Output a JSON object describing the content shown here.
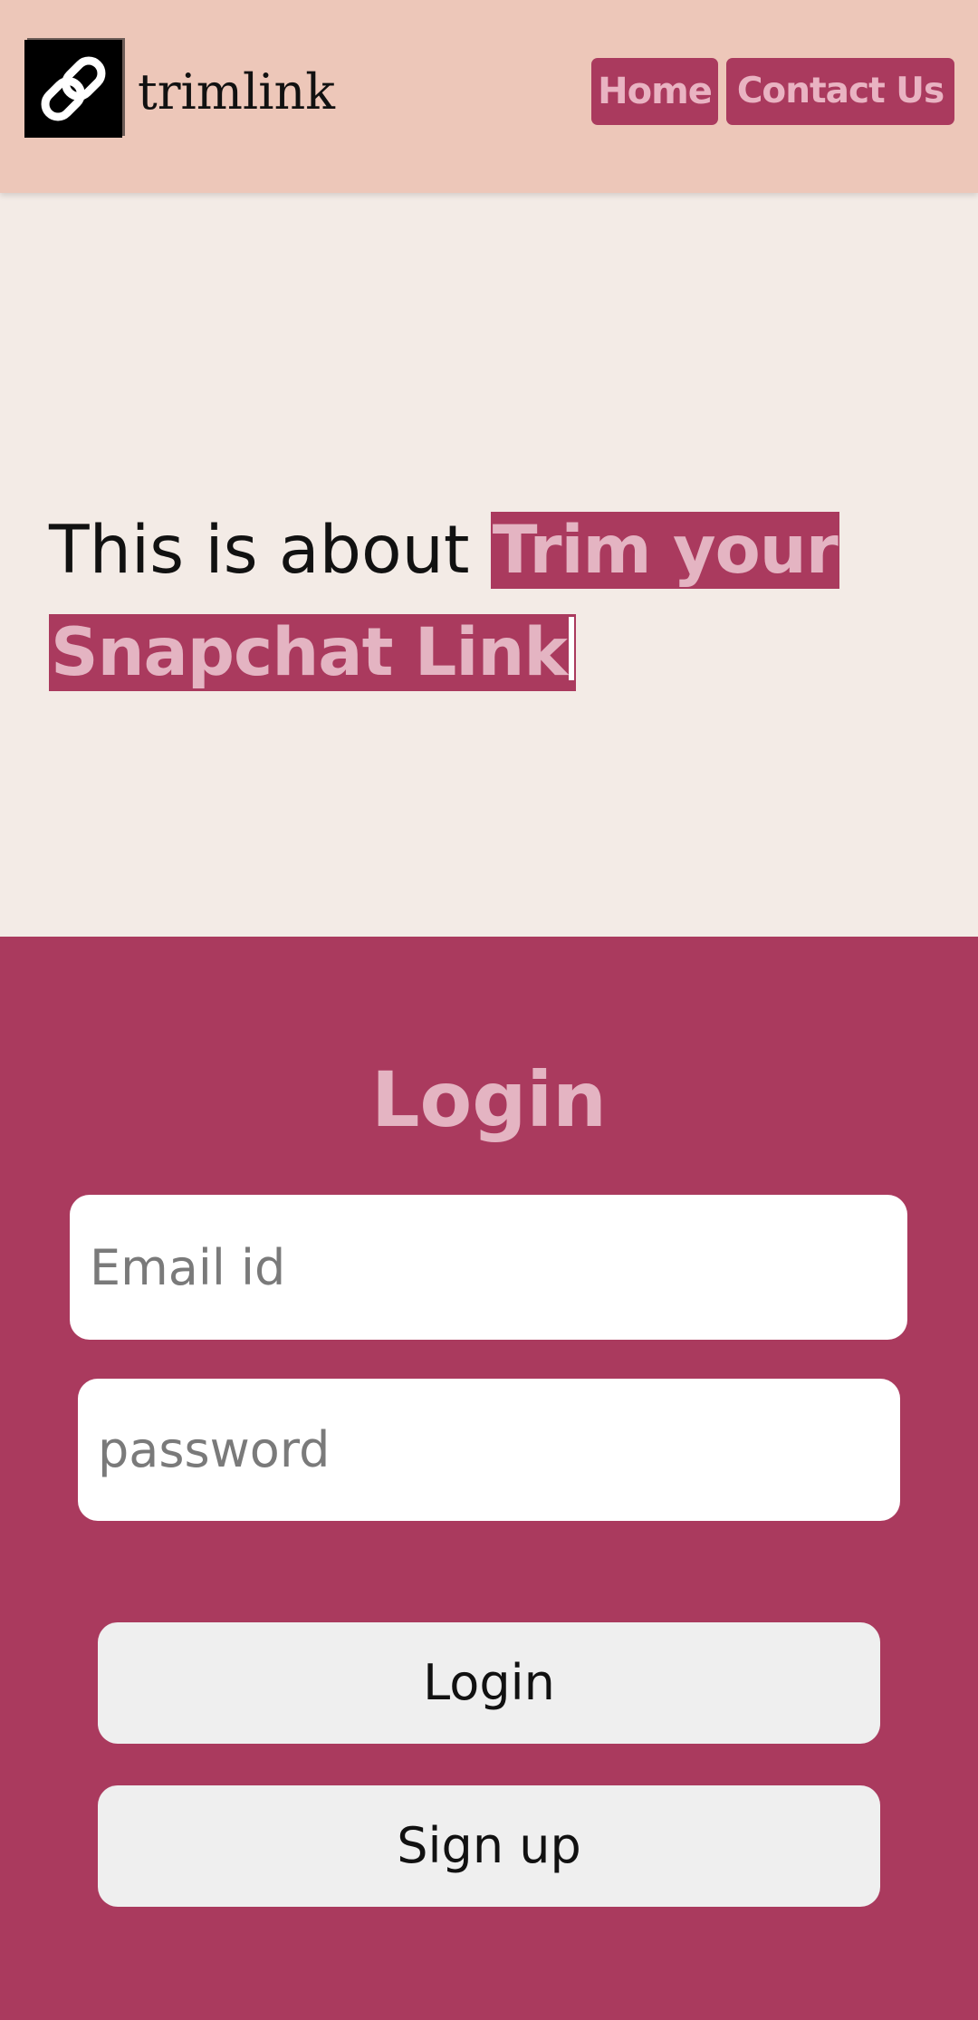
{
  "header": {
    "logo_icon": "link-icon",
    "brand": "trimlink",
    "nav": {
      "home_label": "Home",
      "contact_label": "Contact Us"
    }
  },
  "hero": {
    "lead_text": "This is about ",
    "highlight_text": "Trim your Snapchat Link"
  },
  "login": {
    "title": "Login",
    "email_placeholder": "Email id",
    "password_placeholder": "password",
    "login_label": "Login",
    "signup_label": "Sign up"
  },
  "colors": {
    "header_bg": "#edc7b9",
    "accent": "#aa3a5e",
    "accent_text": "#e4b4c2",
    "hero_bg": "#f3ebe6",
    "button_bg": "#efefef"
  }
}
